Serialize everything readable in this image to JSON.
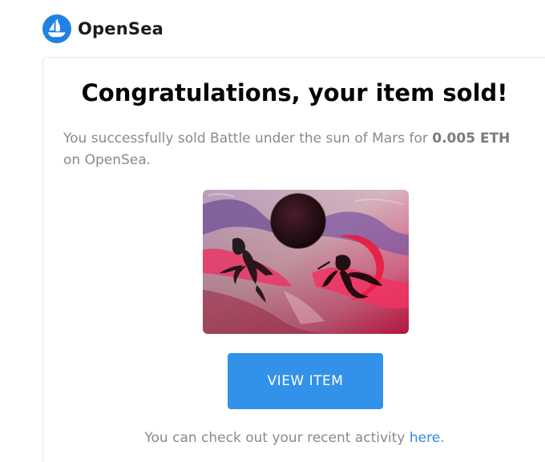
{
  "header": {
    "logo_icon": "opensea-logo-icon",
    "brand_name": "OpenSea",
    "brand_color": "#2081e2"
  },
  "email": {
    "title": "Congratulations, your item sold!",
    "message_prefix": "You successfully sold Battle under the sun of Mars for ",
    "price": "0.005 ETH",
    "message_suffix": " on OpenSea.",
    "item_image_alt": "Battle under the sun of Mars",
    "view_button_label": "VIEW ITEM",
    "button_color": "#3291e9",
    "footer_prefix": "You can check out your recent activity ",
    "footer_link": "here",
    "footer_suffix": ".",
    "link_color": "#2d8ce6"
  }
}
